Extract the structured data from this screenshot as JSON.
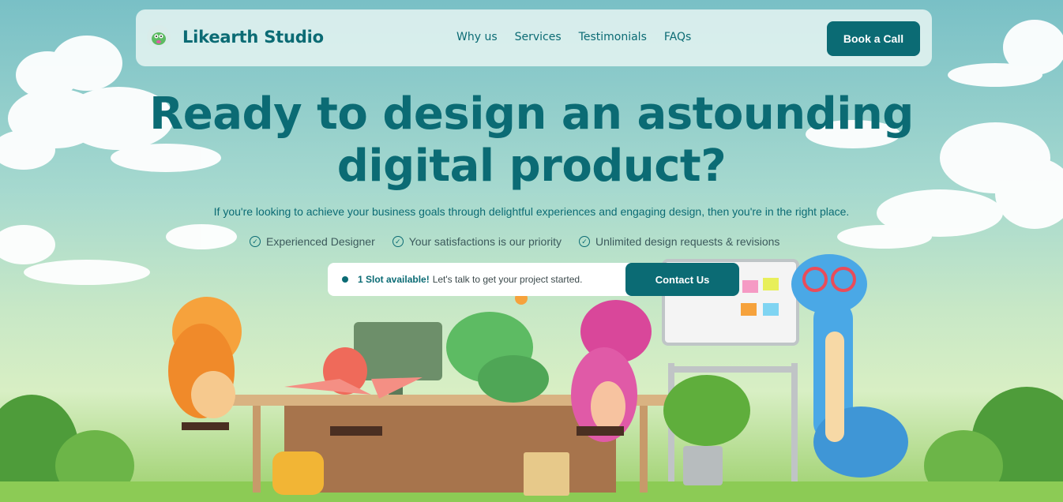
{
  "nav": {
    "brand": "Likearth Studio",
    "links": [
      "Why us",
      "Services",
      "Testimonials",
      "FAQs"
    ],
    "cta_label": "Book a Call"
  },
  "hero": {
    "headline_line1": "Ready to design an astounding",
    "headline_line2": "digital product?",
    "subtitle": "If you're looking to achieve your business goals through delightful experiences and engaging design, then you're in the right place.",
    "features": [
      "Experienced Designer",
      "Your satisfactions is our priority",
      "Unlimited design requests & revisions"
    ],
    "slot_label": "1 Slot available!",
    "slot_rest": "Let's talk to get your project started.",
    "contact_label": "Contact Us"
  },
  "colors": {
    "brand": "#0b6b74",
    "sky": "#79c0c6",
    "grass": "#9bcf6a"
  },
  "icons": [
    "dino-logo-icon",
    "check-circle-icon",
    "status-dot-icon",
    "fire-icon"
  ]
}
